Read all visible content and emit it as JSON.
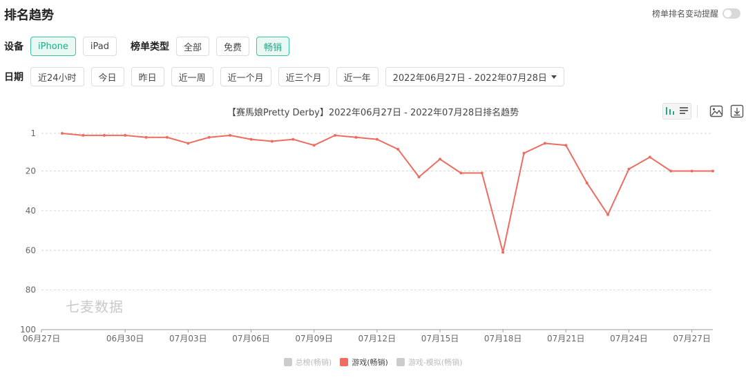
{
  "header": {
    "title": "排名趋势",
    "alert_toggle_label": "榜单排名变动提醒"
  },
  "device": {
    "label": "设备",
    "options": [
      "iPhone",
      "iPad"
    ],
    "selected": "iPhone"
  },
  "chart_type": {
    "label": "榜单类型",
    "options": [
      "全部",
      "免费",
      "畅销"
    ],
    "selected": "畅销"
  },
  "date": {
    "label": "日期",
    "options": [
      "近24小时",
      "今日",
      "昨日",
      "近一周",
      "近一个月",
      "近三个月",
      "近一年"
    ],
    "range": "2022年06月27日 - 2022年07月28日"
  },
  "watermark": "七麦数据",
  "icons": {
    "bar_chart": "bar-chart-icon",
    "list": "list-icon",
    "image": "image-icon",
    "download": "download-icon"
  },
  "chart_data": {
    "type": "line",
    "title": "【赛馬娘Pretty Derby】2022年06月27日 - 2022年07月28日排名趋势",
    "y_reversed": true,
    "ylim": [
      1,
      100
    ],
    "y_ticks": [
      1,
      20,
      40,
      60,
      80,
      100
    ],
    "x": [
      "06月27日",
      "06月28日",
      "06月29日",
      "06月30日",
      "07月01日",
      "07月02日",
      "07月03日",
      "07月04日",
      "07月05日",
      "07月06日",
      "07月07日",
      "07月08日",
      "07月09日",
      "07月10日",
      "07月11日",
      "07月12日",
      "07月13日",
      "07月14日",
      "07月15日",
      "07月16日",
      "07月17日",
      "07月18日",
      "07月19日",
      "07月20日",
      "07月21日",
      "07月22日",
      "07月23日",
      "07月24日",
      "07月25日",
      "07月26日",
      "07月27日",
      "07月28日"
    ],
    "x_tick_labels": [
      "06月27日",
      "06月30日",
      "07月03日",
      "07月06日",
      "07月09日",
      "07月12日",
      "07月15日",
      "07月18日",
      "07月21日",
      "07月24日",
      "07月27日"
    ],
    "series": [
      {
        "name": "游戏(畅销)",
        "color": "#ee6c5f",
        "values": [
          1,
          2,
          2,
          2,
          3,
          3,
          6,
          3,
          2,
          4,
          5,
          4,
          7,
          2,
          3,
          4,
          9,
          23,
          14,
          21,
          21,
          61,
          11,
          6,
          7,
          26,
          42,
          19,
          13,
          20,
          20,
          20
        ]
      }
    ],
    "legend": [
      {
        "name": "总榜(畅销)",
        "color": "#cccccc",
        "active": false
      },
      {
        "name": "游戏(畅销)",
        "color": "#ee6c5f",
        "active": true
      },
      {
        "name": "游戏-模拟(畅销)",
        "color": "#cccccc",
        "active": false
      }
    ],
    "legend_position": "bottom-center",
    "grid": true
  }
}
